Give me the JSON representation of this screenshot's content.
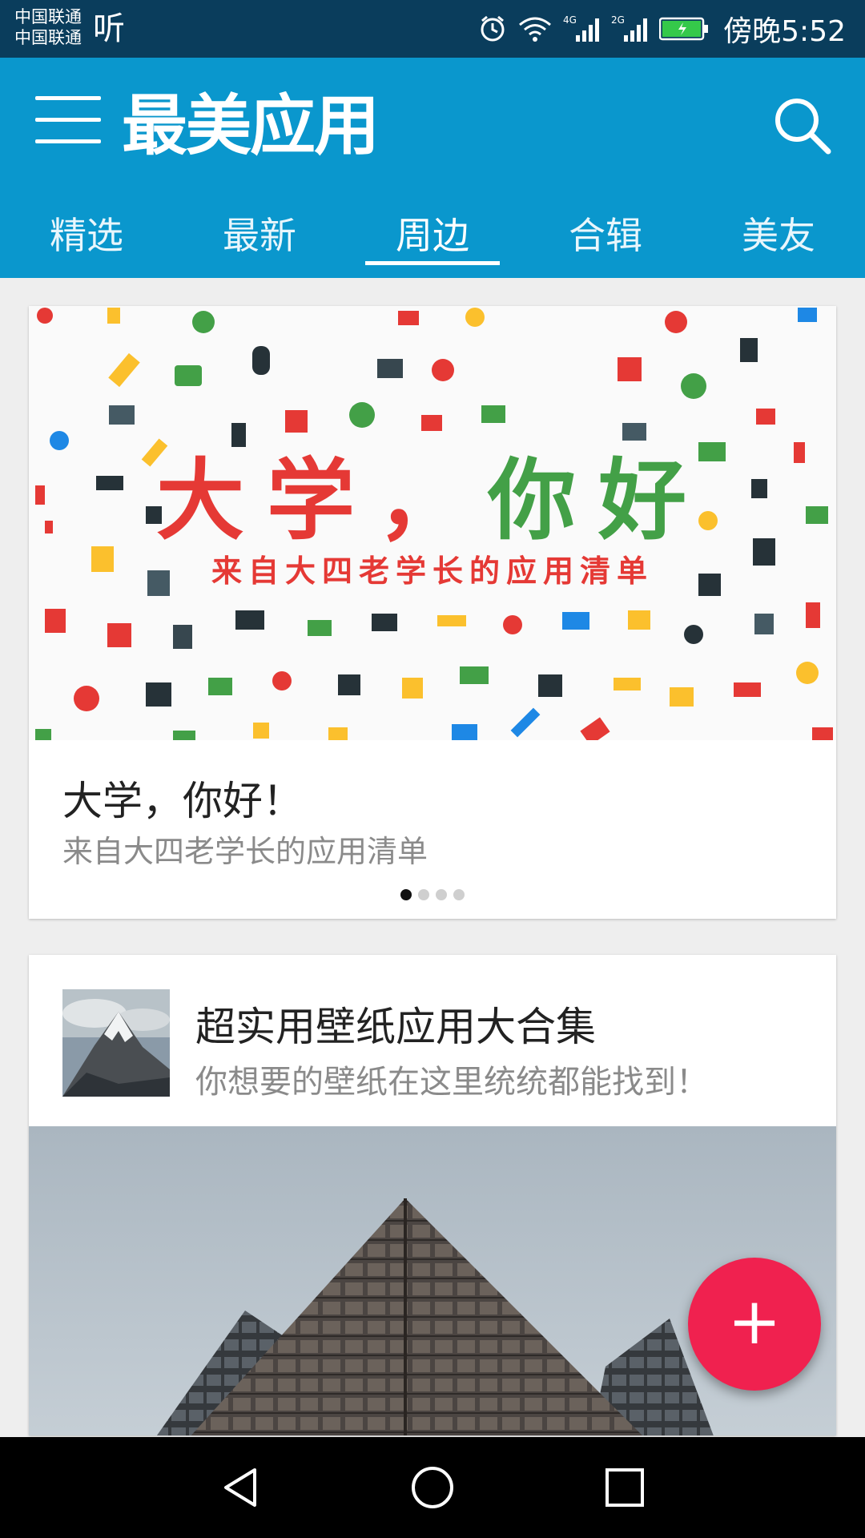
{
  "status_bar": {
    "carrier1": "中国联通",
    "carrier2": "中国联通",
    "listen": "听",
    "net1": "4G",
    "net2": "2G",
    "time": "傍晚5:52",
    "icons": [
      "alarm-icon",
      "wifi-icon",
      "signal-icon",
      "signal-icon",
      "battery-icon"
    ]
  },
  "app_bar": {
    "title": "最美应用",
    "tabs": [
      {
        "label": "精选"
      },
      {
        "label": "最新"
      },
      {
        "label": "周边"
      },
      {
        "label": "合辑"
      },
      {
        "label": "美友"
      }
    ],
    "active_tab": "周边"
  },
  "featured": {
    "banner_title_part1": "大学，",
    "banner_title_part2": "你好",
    "banner_subtitle": "来自大四老学长的应用清单",
    "title": "大学，你好！",
    "subtitle": "来自大四老学长的应用清单",
    "pager_total": 4,
    "pager_current": 1
  },
  "collection": {
    "title": "超实用壁纸应用大合集",
    "subtitle": "你想要的壁纸在这里统统都能找到！"
  },
  "fab": {
    "label": "+"
  },
  "colors": {
    "status_bar": "#0a3d5c",
    "app_bar": "#0a97cd",
    "fab": "#f0214f",
    "background": "#eeeeee"
  }
}
